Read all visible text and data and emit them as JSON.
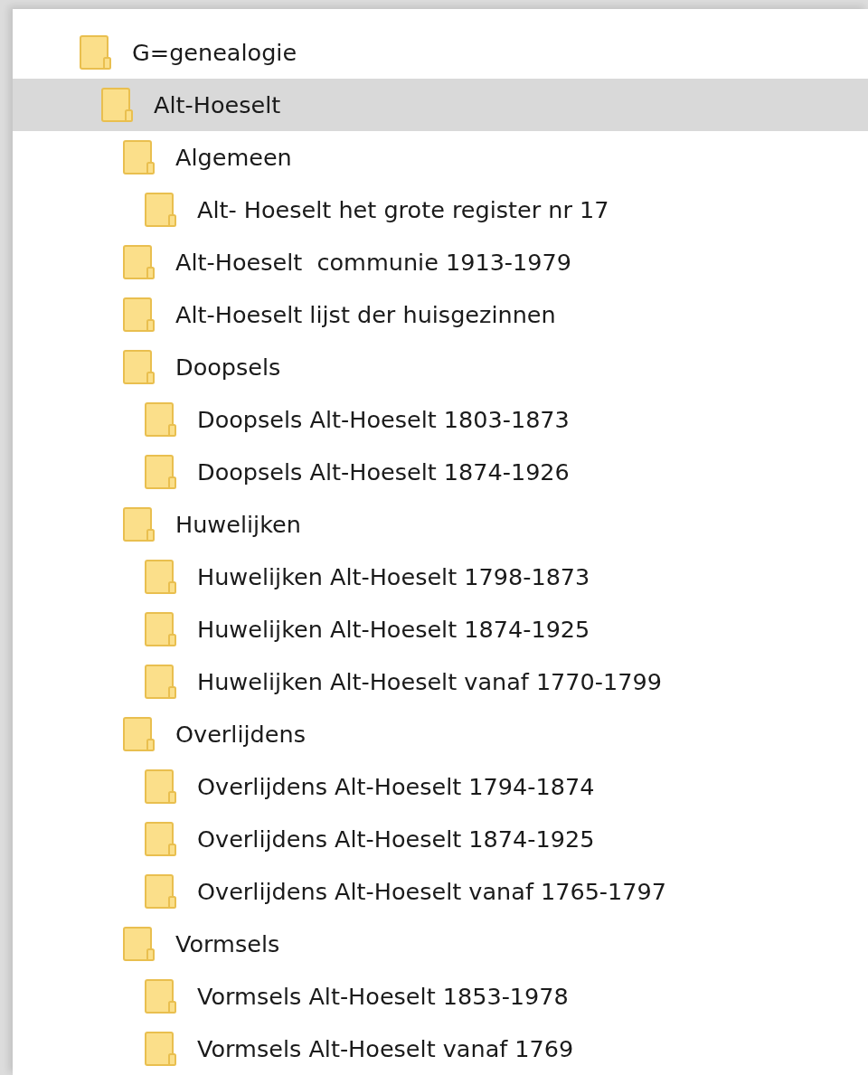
{
  "tree": [
    {
      "label": "G=genealogie",
      "selected": false,
      "children": [
        {
          "label": "Alt-Hoeselt",
          "selected": true,
          "children": [
            {
              "label": "Algemeen",
              "selected": false,
              "children": [
                {
                  "label": "Alt- Hoeselt het grote register nr 17",
                  "selected": false
                }
              ]
            },
            {
              "label": "Alt-Hoeselt  communie 1913-1979",
              "selected": false
            },
            {
              "label": "Alt-Hoeselt lijst der huisgezinnen",
              "selected": false
            },
            {
              "label": "Doopsels",
              "selected": false,
              "children": [
                {
                  "label": "Doopsels Alt-Hoeselt 1803-1873",
                  "selected": false
                },
                {
                  "label": "Doopsels Alt-Hoeselt 1874-1926",
                  "selected": false
                }
              ]
            },
            {
              "label": "Huwelijken",
              "selected": false,
              "children": [
                {
                  "label": "Huwelijken Alt-Hoeselt 1798-1873",
                  "selected": false
                },
                {
                  "label": "Huwelijken Alt-Hoeselt 1874-1925",
                  "selected": false
                },
                {
                  "label": "Huwelijken Alt-Hoeselt vanaf 1770-1799",
                  "selected": false
                }
              ]
            },
            {
              "label": "Overlijdens",
              "selected": false,
              "children": [
                {
                  "label": "Overlijdens Alt-Hoeselt 1794-1874",
                  "selected": false
                },
                {
                  "label": "Overlijdens Alt-Hoeselt 1874-1925",
                  "selected": false
                },
                {
                  "label": "Overlijdens Alt-Hoeselt vanaf 1765-1797",
                  "selected": false
                }
              ]
            },
            {
              "label": "Vormsels",
              "selected": false,
              "children": [
                {
                  "label": "Vormsels Alt-Hoeselt 1853-1978",
                  "selected": false
                },
                {
                  "label": "Vormsels Alt-Hoeselt vanaf 1769",
                  "selected": false
                }
              ]
            }
          ]
        }
      ]
    }
  ]
}
